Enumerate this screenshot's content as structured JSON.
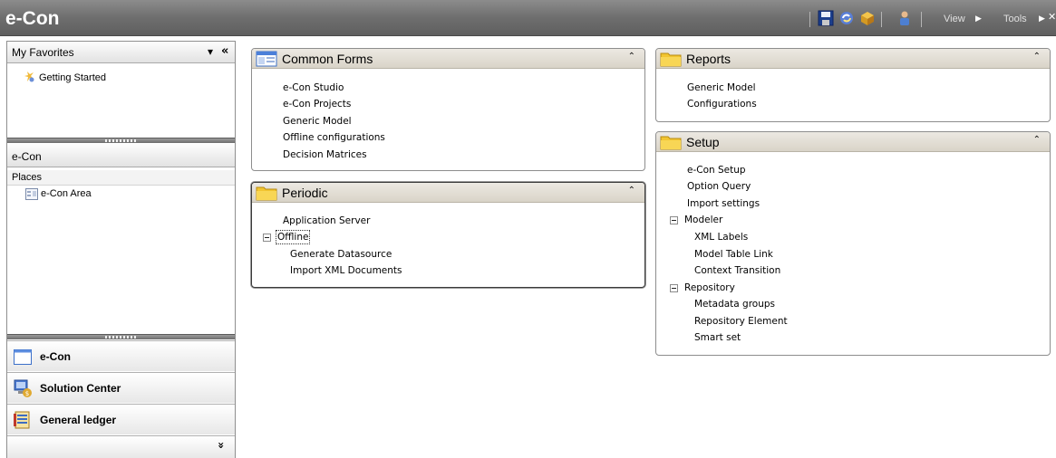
{
  "app": {
    "title": "e-Con"
  },
  "toolbar": {
    "icons": [
      "save-icon",
      "refresh-icon",
      "package-icon",
      "user-icon"
    ],
    "view_label": "View",
    "tools_label": "Tools",
    "arrow": "▶",
    "close": "✕"
  },
  "nav": {
    "favorites": {
      "title": "My Favorites",
      "dropdown": "▾",
      "collapse": "«",
      "items": [
        "Getting Started"
      ]
    },
    "module": {
      "title": "e-Con",
      "places_label": "Places",
      "places": [
        "e-Con Area"
      ]
    },
    "buttons": [
      {
        "label": "e-Con",
        "icon": "window-icon"
      },
      {
        "label": "Solution Center",
        "icon": "solution-center-icon"
      },
      {
        "label": "General ledger",
        "icon": "general-ledger-icon"
      }
    ],
    "more": "»"
  },
  "panels": {
    "common_forms": {
      "title": "Common Forms",
      "items": [
        "e-Con Studio",
        "e-Con Projects",
        "Generic Model",
        "Offline configurations",
        "Decision Matrices"
      ]
    },
    "periodic": {
      "title": "Periodic",
      "items": [
        "Application Server"
      ],
      "offline_group": "Offline",
      "offline_items": [
        "Generate Datasource",
        "Import XML Documents"
      ]
    },
    "reports": {
      "title": "Reports",
      "items": [
        "Generic Model",
        "Configurations"
      ]
    },
    "setup": {
      "title": "Setup",
      "items": [
        "e-Con Setup",
        "Option Query",
        "Import settings"
      ],
      "modeler_group": "Modeler",
      "modeler_items": [
        "XML Labels",
        "Model Table Link",
        "Context Transition"
      ],
      "repository_group": "Repository",
      "repository_items": [
        "Metadata groups",
        "Repository Element",
        "Smart set"
      ]
    },
    "collapse_glyph": "⌃"
  },
  "colors": {
    "titlebar": "#6e6e6e",
    "panel_header": "#ddd8cc",
    "folder": "#f2c531"
  }
}
